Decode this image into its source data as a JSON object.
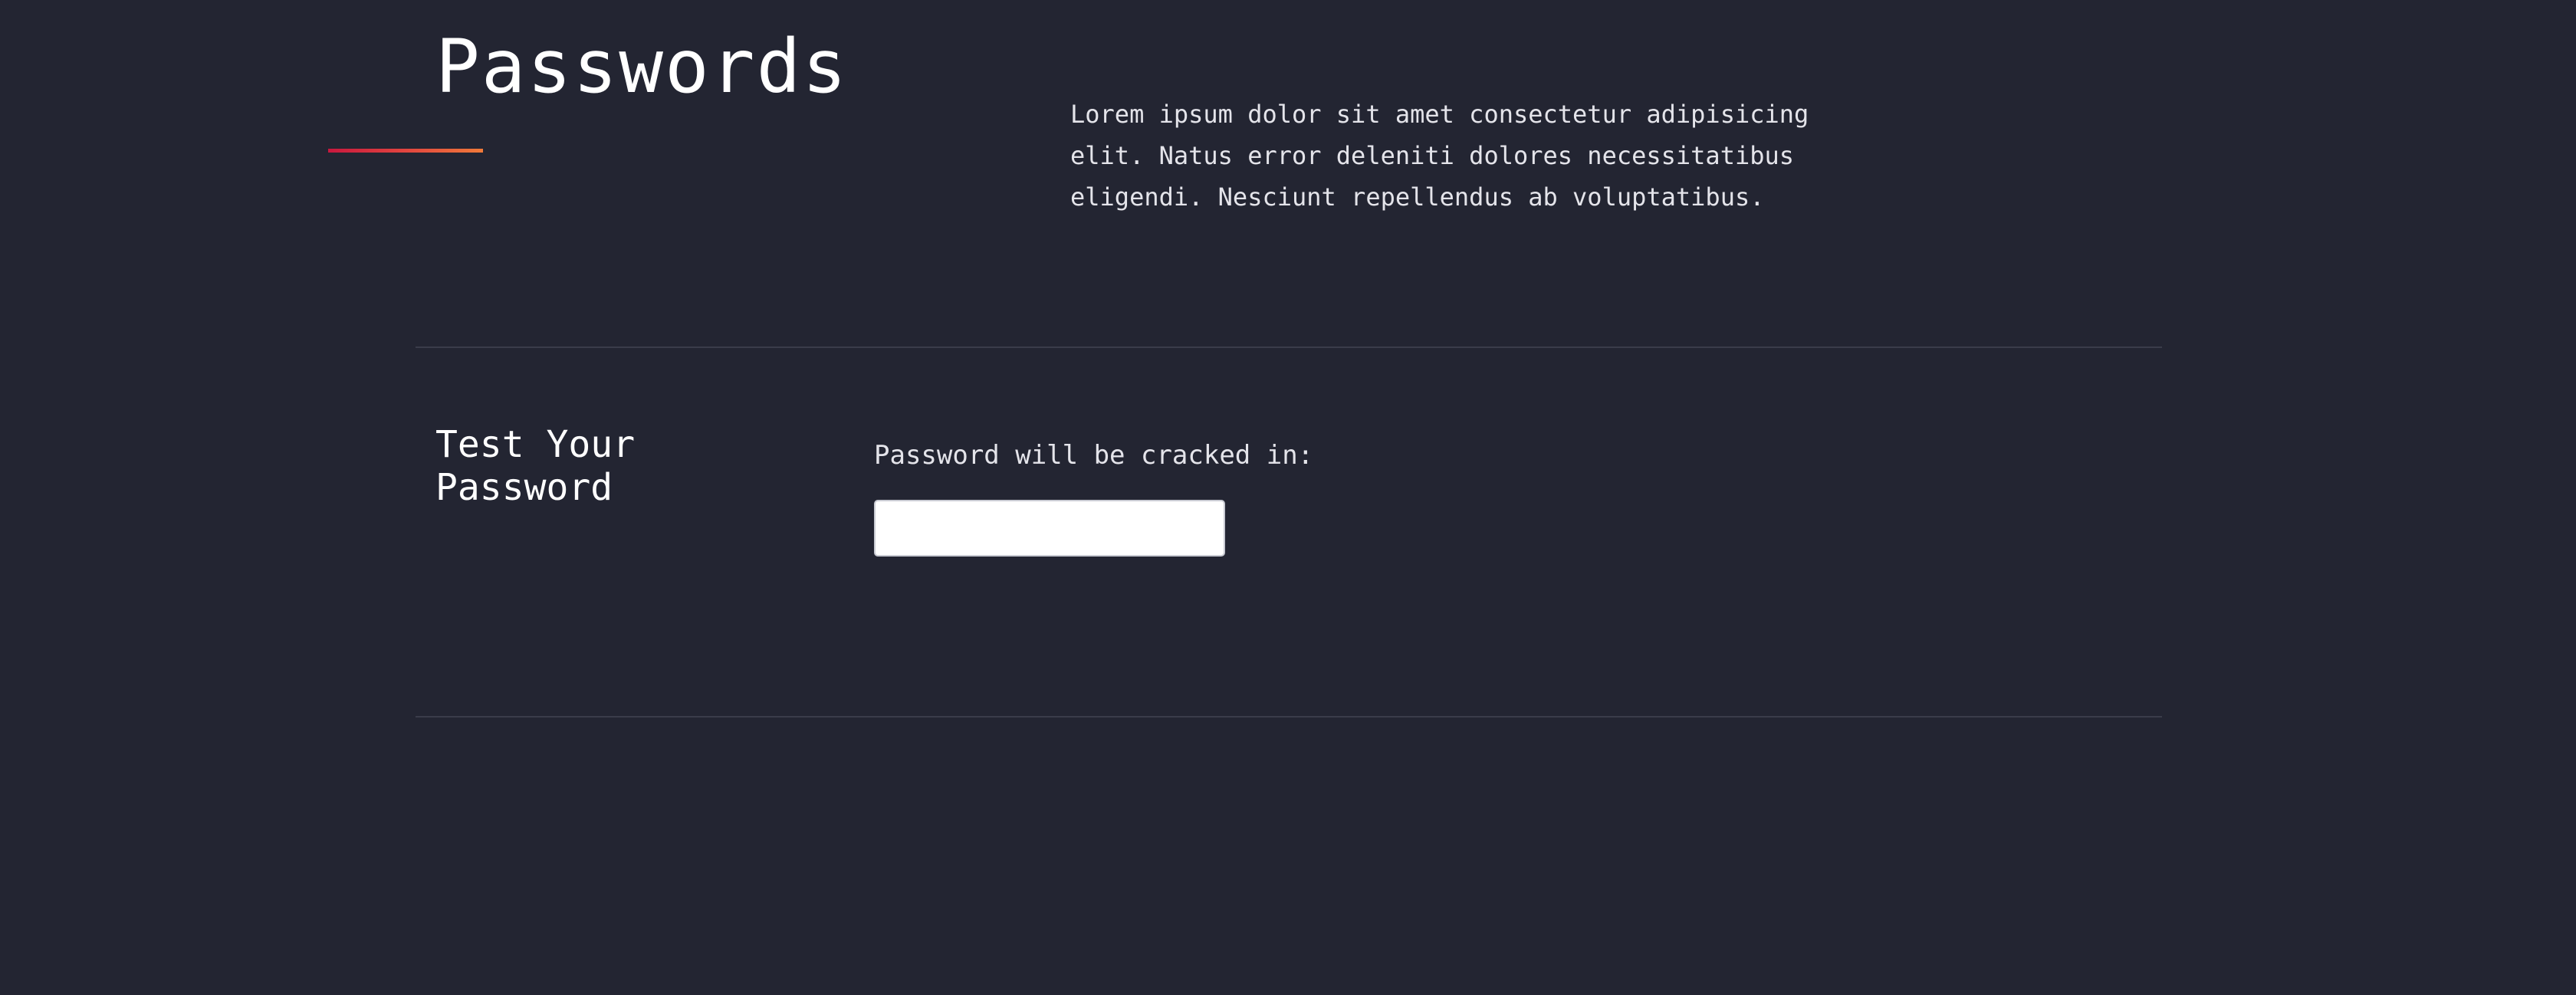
{
  "header": {
    "title": "Passwords",
    "intro": "Lorem ipsum dolor sit amet consectetur adipisicing elit. Natus error deleniti dolores necessitatibus eligendi. Nesciunt repellendus ab voluptatibus.",
    "underline_gradient": [
      "#c8183e",
      "#e2453f",
      "#f07a3a"
    ]
  },
  "tester": {
    "heading": "Test Your Password",
    "crack_label": "Password will be cracked in:",
    "input_value": "",
    "input_placeholder": ""
  },
  "colors": {
    "background": "#232532",
    "text": "#ffffff",
    "muted_text": "#e4e4ea",
    "divider": "#3a3c4a"
  }
}
